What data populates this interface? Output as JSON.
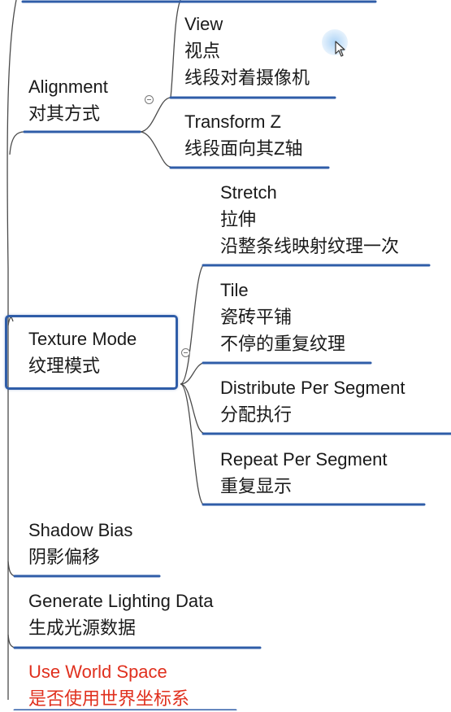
{
  "colors": {
    "branch_line": "#2f5da8",
    "connector": "#4b4b4b",
    "selected_border": "#2f5da8",
    "highlight_text": "#e0301e"
  },
  "nodes": {
    "view": {
      "en": "View",
      "zh": "视点",
      "desc": "线段对着摄像机"
    },
    "alignment": {
      "en": "Alignment",
      "zh": "对其方式"
    },
    "transform_z": {
      "en": "Transform Z",
      "zh": "线段面向其Z轴"
    },
    "stretch": {
      "en": "Stretch",
      "zh": "拉伸",
      "desc": "沿整条线映射纹理一次"
    },
    "tile": {
      "en": "Tile",
      "zh": "瓷砖平铺",
      "desc": "不停的重复纹理"
    },
    "texture_mode": {
      "en": "Texture Mode",
      "zh": "纹理模式"
    },
    "distribute": {
      "en": "Distribute Per Segment",
      "zh": "分配执行"
    },
    "repeat": {
      "en": "Repeat Per Segment",
      "zh": "重复显示"
    },
    "shadow_bias": {
      "en": "Shadow Bias",
      "zh": "阴影偏移"
    },
    "lighting": {
      "en": "Generate Lighting Data",
      "zh": "生成光源数据"
    },
    "world_space": {
      "en": "Use World Space",
      "zh": "是否使用世界坐标系"
    }
  },
  "icons": {
    "collapse": "minus-circle-icon",
    "cursor": "mouse-pointer-icon"
  }
}
